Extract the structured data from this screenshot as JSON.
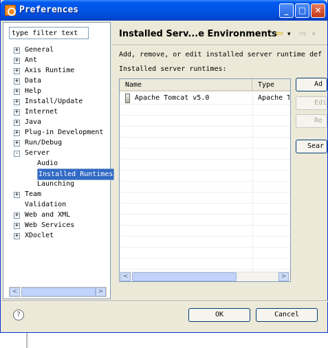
{
  "window": {
    "title": "Preferences"
  },
  "titlebar_buttons": {
    "minimize": "_",
    "maximize": "□",
    "close": "✕"
  },
  "filter": {
    "value": "type filter text"
  },
  "tree": {
    "items": [
      {
        "label": "General",
        "expander": "+",
        "level": 0
      },
      {
        "label": "Ant",
        "expander": "+",
        "level": 0
      },
      {
        "label": "Axis Runtime",
        "expander": "+",
        "level": 0
      },
      {
        "label": "Data",
        "expander": "+",
        "level": 0
      },
      {
        "label": "Help",
        "expander": "+",
        "level": 0
      },
      {
        "label": "Install/Update",
        "expander": "+",
        "level": 0
      },
      {
        "label": "Internet",
        "expander": "+",
        "level": 0
      },
      {
        "label": "Java",
        "expander": "+",
        "level": 0
      },
      {
        "label": "Plug-in Development",
        "expander": "+",
        "level": 0
      },
      {
        "label": "Run/Debug",
        "expander": "+",
        "level": 0
      },
      {
        "label": "Server",
        "expander": "-",
        "level": 0
      },
      {
        "label": "Audio",
        "expander": "",
        "level": 1
      },
      {
        "label": "Installed Runtimes",
        "expander": "",
        "level": 1,
        "selected": true
      },
      {
        "label": "Launching",
        "expander": "",
        "level": 1
      },
      {
        "label": "Team",
        "expander": "+",
        "level": 0
      },
      {
        "label": "Validation",
        "expander": "",
        "level": 0
      },
      {
        "label": "Web and XML",
        "expander": "+",
        "level": 0
      },
      {
        "label": "Web Services",
        "expander": "+",
        "level": 0
      },
      {
        "label": "XDoclet",
        "expander": "+",
        "level": 0
      }
    ]
  },
  "scroll_arrows": {
    "left": "<",
    "right": ">"
  },
  "page": {
    "title": "Installed Serv...e Environments",
    "back_icon": "⇦",
    "forward_icon": "⇨",
    "back_dropdown": "▾",
    "forward_dropdown": "▾",
    "description": "Add, remove, or edit installed server runtime def",
    "list_label": "Installed server runtimes:"
  },
  "table": {
    "columns": [
      "Name",
      "Type"
    ],
    "rows": [
      {
        "name": "Apache Tomcat v5.0",
        "type": "Apache T"
      }
    ]
  },
  "side_buttons": {
    "add": "Ad",
    "edit": "Edi",
    "remove": "Re",
    "search": "Sear"
  },
  "footer": {
    "help": "?",
    "ok": "OK",
    "cancel": "Cancel"
  },
  "colors": {
    "selection": "#316ac5",
    "titlebar": "#0055e5",
    "dialog_bg": "#ece9d8"
  }
}
